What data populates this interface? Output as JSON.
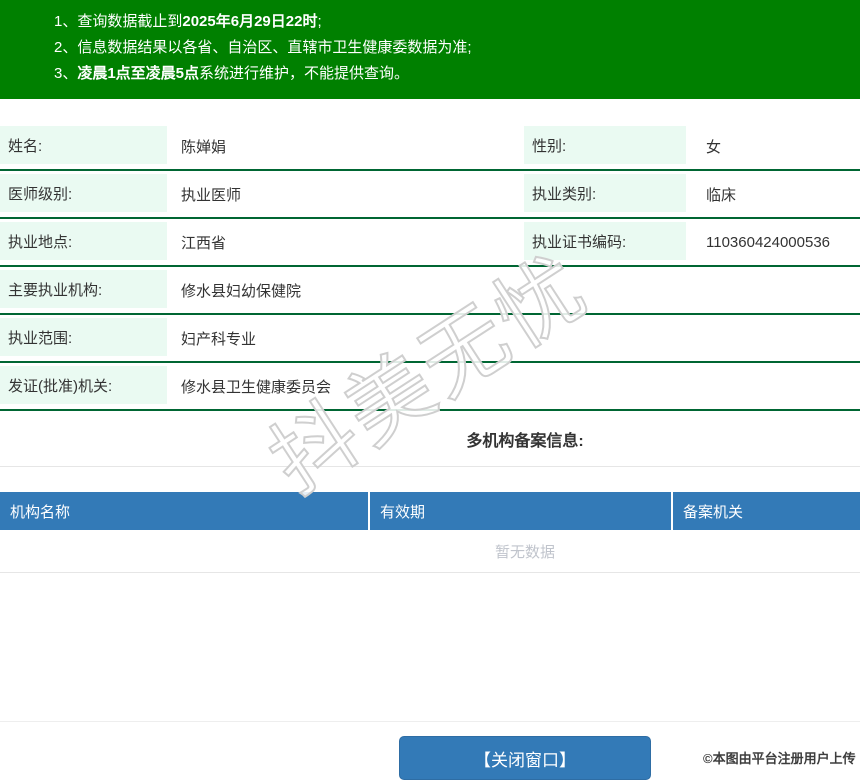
{
  "notices": [
    {
      "num": "1、",
      "pre": "查询数据截止到",
      "bold": "2025年6月29日22时",
      "post": ";"
    },
    {
      "num": "2、",
      "pre": "信息数据结果以各省、自治区、直辖市卫生健康委数据为准;",
      "bold": "",
      "post": ""
    },
    {
      "num": "3、",
      "pre": "",
      "bold": "凌晨1点至凌晨5点",
      "post": "系统进行维护，不能提供查询。"
    }
  ],
  "info": {
    "rows": [
      {
        "label1": "姓名:",
        "value1": "陈婵娟",
        "label2": "性别:",
        "value2": "女"
      },
      {
        "label1": "医师级别:",
        "value1": "执业医师",
        "label2": "执业类别:",
        "value2": "临床"
      },
      {
        "label1": "执业地点:",
        "value1": "江西省",
        "label2": "执业证书编码:",
        "value2": "110360424000536"
      },
      {
        "label1": "主要执业机构:",
        "value1": "修水县妇幼保健院"
      },
      {
        "label1": "执业范围:",
        "value1": "妇产科专业"
      },
      {
        "label1": "发证(批准)机关:",
        "value1": "修水县卫生健康委员会"
      }
    ]
  },
  "multi_org": {
    "title": "多机构备案信息:",
    "columns": [
      "机构名称",
      "有效期",
      "备案机关"
    ],
    "empty_text": "暂无数据"
  },
  "close_button_label": "【关闭窗口】",
  "watermark_text": "抖美无忧",
  "credit_text": "©本图由平台注册用户上传",
  "colors": {
    "banner_green": "#008000",
    "row_divider_green": "#006633",
    "label_cell_mint": "#eafaf2",
    "table_header_blue": "#337ab7",
    "button_border_blue": "#2e6da4",
    "empty_text_gray": "#c0c4cc"
  }
}
